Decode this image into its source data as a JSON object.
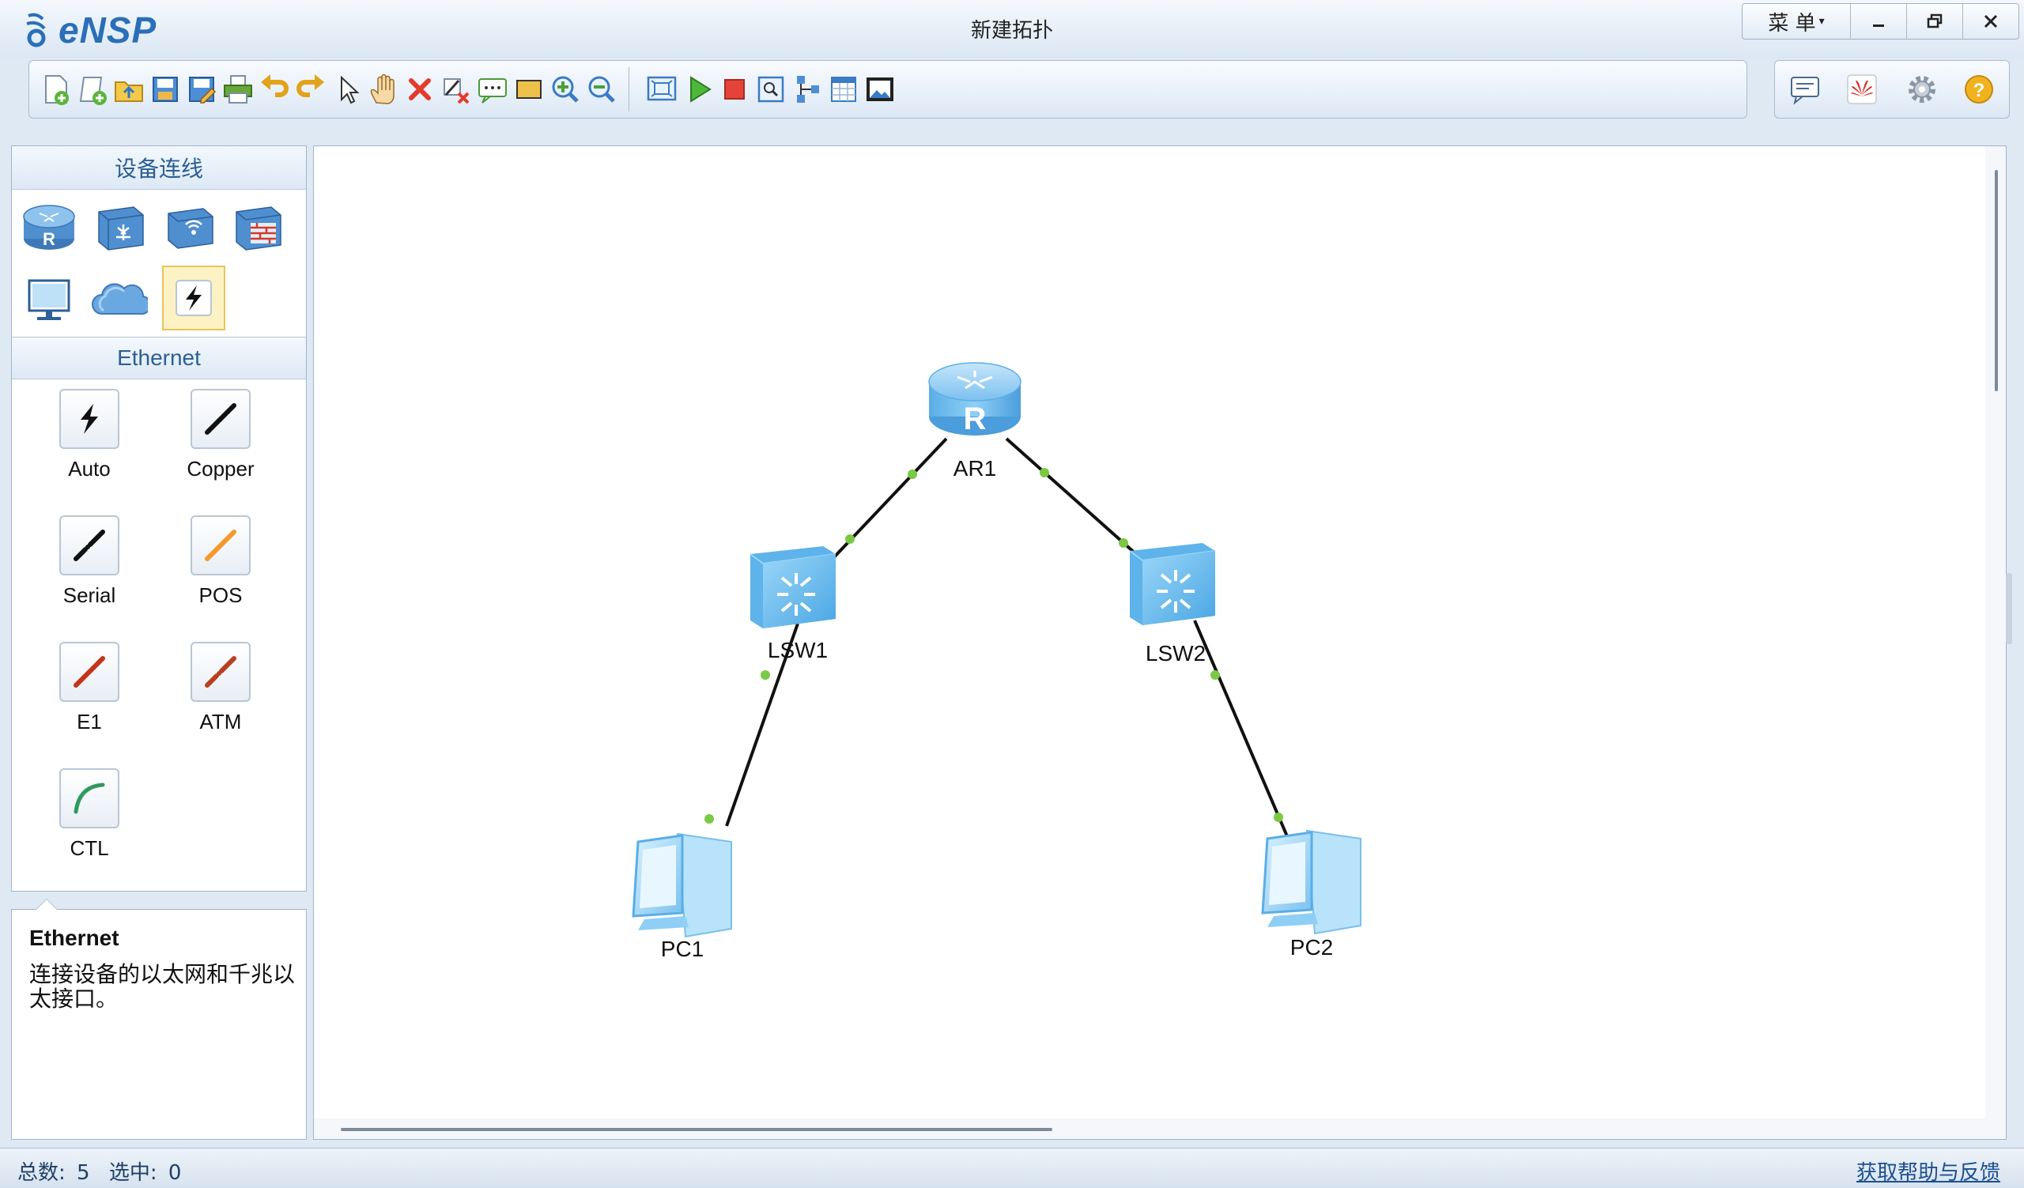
{
  "app": {
    "logo_text": "eNSP",
    "window_title": "新建拓扑",
    "menu_label": "菜 单",
    "minimize_glyph": "—",
    "restore_glyph": "⧉",
    "close_glyph": "✕"
  },
  "toolbar": {
    "icons": [
      "new-topology-icon",
      "new-example-icon",
      "open-icon",
      "save-icon",
      "save-as-icon",
      "print-icon",
      "undo-icon",
      "redo-icon",
      "select-icon",
      "pan-icon",
      "delete-icon",
      "delete-link-icon",
      "text-note-icon",
      "rectangle-icon",
      "zoom-in-icon",
      "zoom-out-icon",
      "fit-view-icon",
      "start-device-icon",
      "stop-device-icon",
      "capture-icon",
      "topology-icon",
      "grid-icon",
      "screenshot-icon"
    ],
    "right_icons": [
      "chat-icon",
      "huawei-icon",
      "settings-icon",
      "help-icon"
    ]
  },
  "left_panel": {
    "header": "设备连线",
    "devices": [
      "router-icon",
      "switch-icon",
      "wireless-icon",
      "firewall-icon",
      "pc-icon",
      "cloud-icon",
      "connection-icon"
    ],
    "selected_category": "connection",
    "sub_header": "Ethernet",
    "cables": [
      {
        "label": "Auto",
        "icon": "auto-cable-icon",
        "color": "#111111"
      },
      {
        "label": "Copper",
        "icon": "copper-cable-icon",
        "color": "#111111"
      },
      {
        "label": "Serial",
        "icon": "serial-cable-icon",
        "color": "#111111"
      },
      {
        "label": "POS",
        "icon": "pos-cable-icon",
        "color": "#f39a2b"
      },
      {
        "label": "E1",
        "icon": "e1-cable-icon",
        "color": "#c3331a"
      },
      {
        "label": "ATM",
        "icon": "atm-cable-icon",
        "color": "#b8401f"
      },
      {
        "label": "CTL",
        "icon": "ctl-cable-icon",
        "color": "#2f9a5c"
      }
    ]
  },
  "description": {
    "title": "Ethernet",
    "text": "连接设备的以太网和千兆以太接口。"
  },
  "topology": {
    "nodes": [
      {
        "id": "AR1",
        "label": "AR1",
        "type": "router"
      },
      {
        "id": "LSW1",
        "label": "LSW1",
        "type": "switch"
      },
      {
        "id": "LSW2",
        "label": "LSW2",
        "type": "switch"
      },
      {
        "id": "PC1",
        "label": "PC1",
        "type": "pc"
      },
      {
        "id": "PC2",
        "label": "PC2",
        "type": "pc"
      }
    ],
    "links": [
      {
        "from": "AR1",
        "to": "LSW1"
      },
      {
        "from": "AR1",
        "to": "LSW2"
      },
      {
        "from": "LSW1",
        "to": "PC1"
      },
      {
        "from": "LSW2",
        "to": "PC2"
      }
    ],
    "link_color": "#111111",
    "port_up_color": "#7ac943"
  },
  "status": {
    "total_label": "总数:",
    "total_value": "5",
    "selected_label": "选中:",
    "selected_value": "0",
    "help_link": "获取帮助与反馈"
  }
}
